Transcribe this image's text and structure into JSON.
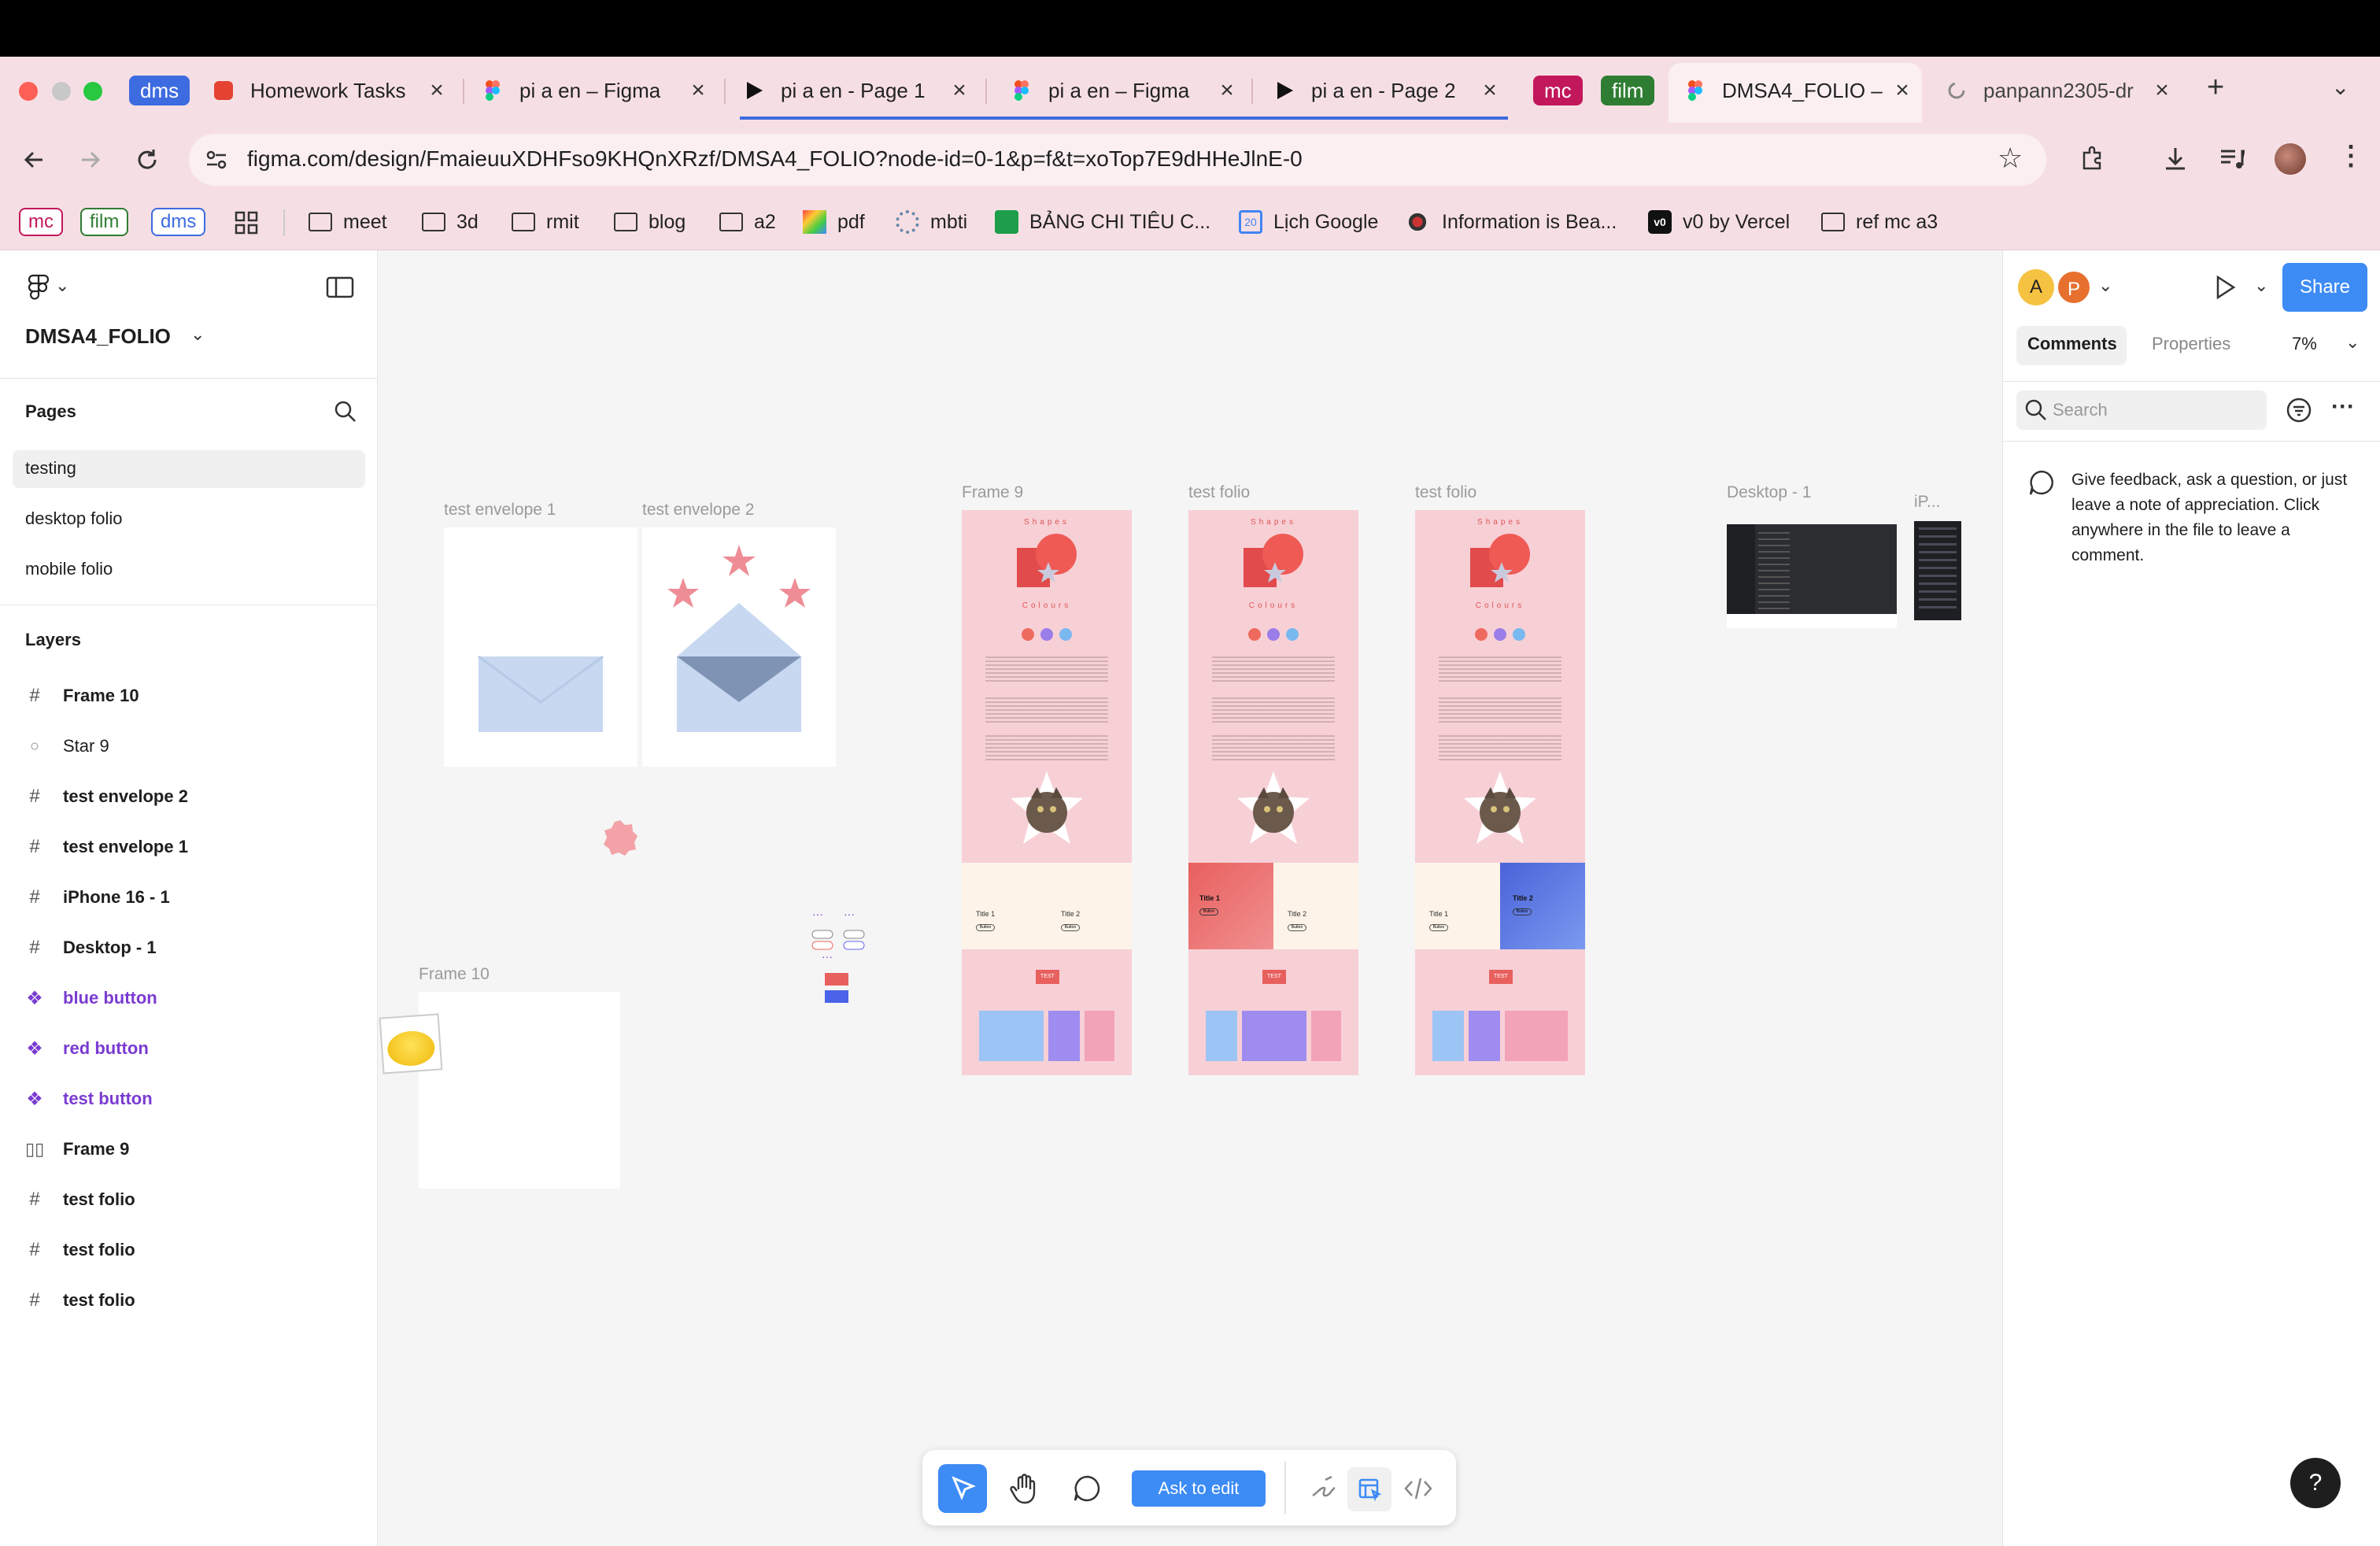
{
  "browser": {
    "tabs": [
      {
        "label": "Homework Tasks"
      },
      {
        "label": "pi a en – Figma"
      },
      {
        "label": "pi a en - Page 1"
      },
      {
        "label": "pi a en – Figma"
      },
      {
        "label": "pi a en - Page 2"
      },
      {
        "label": "DMSA4_FOLIO –"
      },
      {
        "label": "panpann2305-dr"
      }
    ],
    "tab_groups": {
      "dms": "dms",
      "mc": "mc",
      "film": "film"
    },
    "new_tab": "+",
    "url": "figma.com/design/FmaieuuXDHFso9KHQnXRzf/DMSA4_FOLIO?node-id=0-1&p=f&t=xoTop7E9dHHeJlnE-0",
    "bookmarks": {
      "groups": [
        "mc",
        "film",
        "dms"
      ],
      "items": [
        "meet",
        "3d",
        "rmit",
        "blog",
        "a2",
        "pdf",
        "mbti",
        "BẢNG CHI TIÊU C...",
        "Lịch Google",
        "Information is Bea...",
        "v0 by Vercel",
        "ref mc a3"
      ]
    },
    "colors": {
      "dms": "#3d6be0",
      "mc": "#c2185b",
      "film": "#2e7d32",
      "tab_bg": "#f6dfe4"
    }
  },
  "left_panel": {
    "file_name": "DMSA4_FOLIO",
    "pages_title": "Pages",
    "pages": [
      "testing",
      "desktop folio",
      "mobile folio"
    ],
    "layers_title": "Layers",
    "layers": [
      {
        "name": "Frame 10",
        "icon": "frame-icon"
      },
      {
        "name": "Star 9",
        "icon": "star-outline-icon"
      },
      {
        "name": "test envelope 2",
        "icon": "frame-icon"
      },
      {
        "name": "test envelope 1",
        "icon": "frame-icon"
      },
      {
        "name": "iPhone 16 - 1",
        "icon": "frame-icon"
      },
      {
        "name": "Desktop - 1",
        "icon": "frame-icon"
      },
      {
        "name": "blue button",
        "icon": "component-icon"
      },
      {
        "name": "red button",
        "icon": "component-icon"
      },
      {
        "name": "test button",
        "icon": "component-icon"
      },
      {
        "name": "Frame 9",
        "icon": "auto-layout-icon"
      },
      {
        "name": "test folio",
        "icon": "frame-icon"
      },
      {
        "name": "test folio",
        "icon": "frame-icon"
      },
      {
        "name": "test folio",
        "icon": "frame-icon"
      }
    ]
  },
  "canvas": {
    "labels": {
      "env1": "test envelope 1",
      "env2": "test envelope 2",
      "frame10": "Frame 10",
      "folio1": "Frame 9",
      "folio2": "test folio",
      "folio3": "test folio",
      "desktop": "Desktop - 1",
      "iphone": "iP..."
    },
    "folio_text": {
      "shapes": "Shapes",
      "colours": "Colours",
      "title1": "Title 1",
      "title2": "Title 2",
      "button": "Button",
      "test": "TEST"
    }
  },
  "right_panel": {
    "avatars": [
      "A",
      "P"
    ],
    "share": "Share",
    "tabs": [
      "Comments",
      "Properties"
    ],
    "zoom": "7%",
    "search_placeholder": "Search",
    "empty_message": "Give feedback, ask a question, or just leave a note of appreciation. Click anywhere in the file to leave a comment."
  },
  "toolbar": {
    "ask_to_edit": "Ask to edit"
  },
  "help": "?"
}
